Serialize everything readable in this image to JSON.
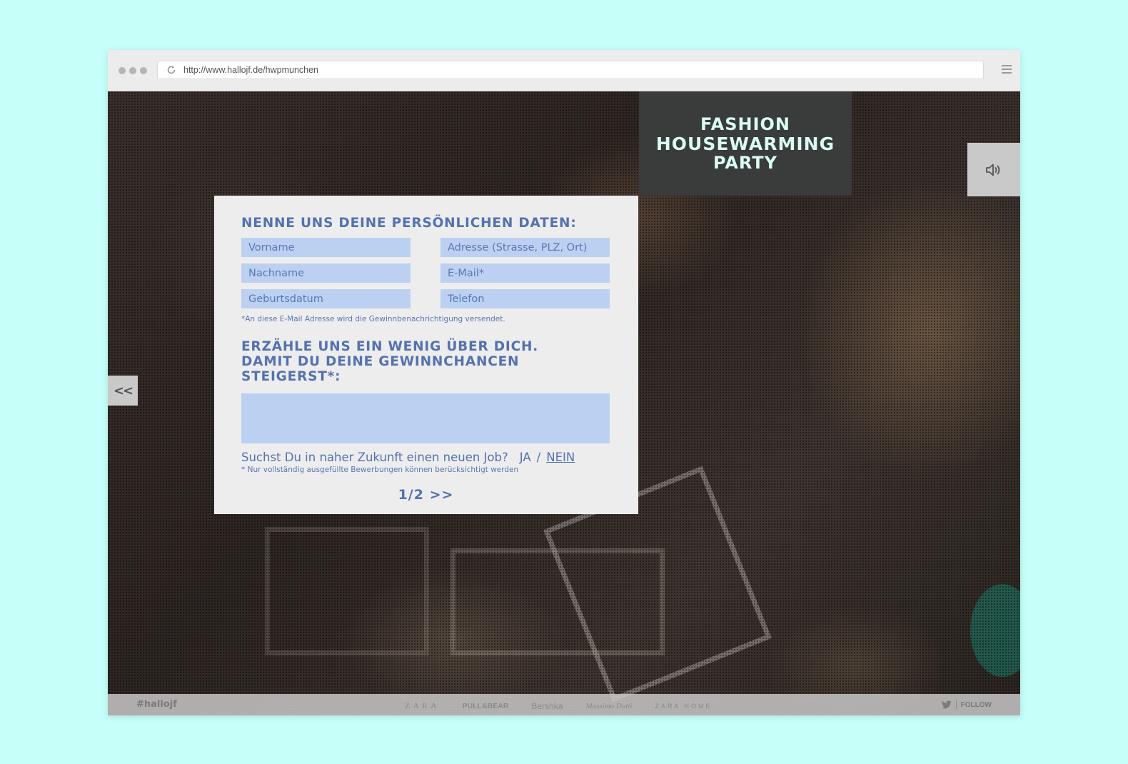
{
  "browser": {
    "url": "http://www.hallojf.de/hwpmunchen"
  },
  "logo": {
    "line1": "FASHION",
    "line2": "HOUSEWARMING",
    "line3": "PARTY"
  },
  "nav": {
    "back_label": "<<"
  },
  "form": {
    "heading1": "NENNE UNS DEINE PERSÖNLICHEN DATEN:",
    "fields": {
      "vorname": "Vorname",
      "adresse": "Adresse (Strasse, PLZ, Ort)",
      "nachname": "Nachname",
      "email": "E-Mail*",
      "geburtsdatum": "Geburtsdatum",
      "telefon": "Telefon"
    },
    "email_note": "*An diese E-Mail Adresse wird die Gewinnbenachrichtigung versendet.",
    "heading2_line1": "ERZÄHLE UNS EIN WENIG ÜBER DICH.",
    "heading2_line2": "DAMIT DU DEINE GEWINNCHANCEN STEIGERST*:",
    "job_question": "Suchst Du in naher Zukunft einen neuen Job?",
    "job_yes": "JA",
    "job_separator": "/",
    "job_no": "NEIN",
    "complete_note": "* Nur vollständig ausgefüllte Bewerbungen können berücksichtigt werden",
    "pager_text": "1/2",
    "next_label": ">>"
  },
  "footer": {
    "hashtag": "#hallojf",
    "brands": [
      "ZARA",
      "PULL&BEAR",
      "Bershka",
      "Massimo Dutti",
      "ZARA HOME"
    ],
    "follow_label": "FOLLOW"
  },
  "colors": {
    "page_background": "#c6fff9",
    "form_accent": "#5472ad",
    "field_fill": "#bcd0f1",
    "logo_text": "#d9fbf4"
  }
}
